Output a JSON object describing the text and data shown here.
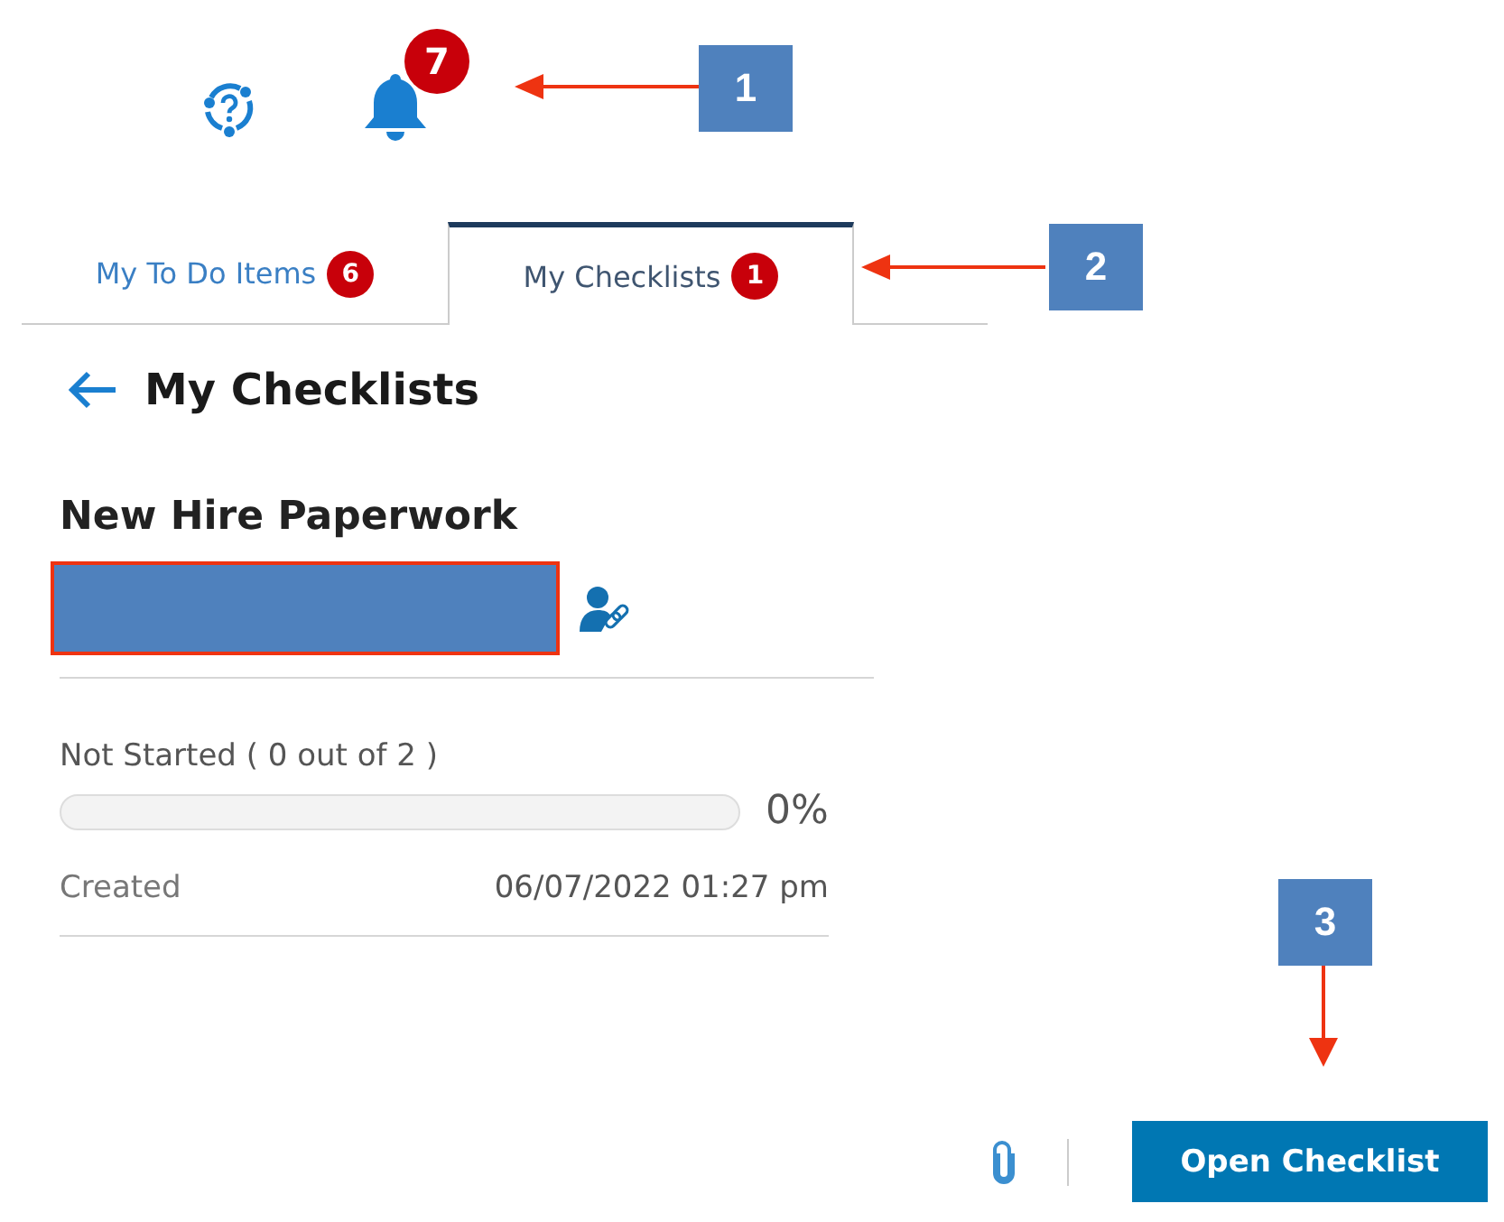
{
  "header": {
    "notification_count": "7"
  },
  "tabs": [
    {
      "label": "My To Do Items",
      "count": "6",
      "selected": false
    },
    {
      "label": "My Checklists",
      "count": "1",
      "selected": true
    }
  ],
  "page_title": "My Checklists",
  "checklist": {
    "name": "New Hire Paperwork",
    "status": "Not Started ( 0 out of 2 )",
    "level": 0,
    "percent": "0%",
    "created_label": "Created",
    "created_value": "06/07/2022 01:27 pm"
  },
  "footer": {
    "button": "Open Checklist"
  },
  "callouts": [
    {
      "number": "1"
    },
    {
      "number": "2"
    },
    {
      "number": "3"
    }
  ]
}
